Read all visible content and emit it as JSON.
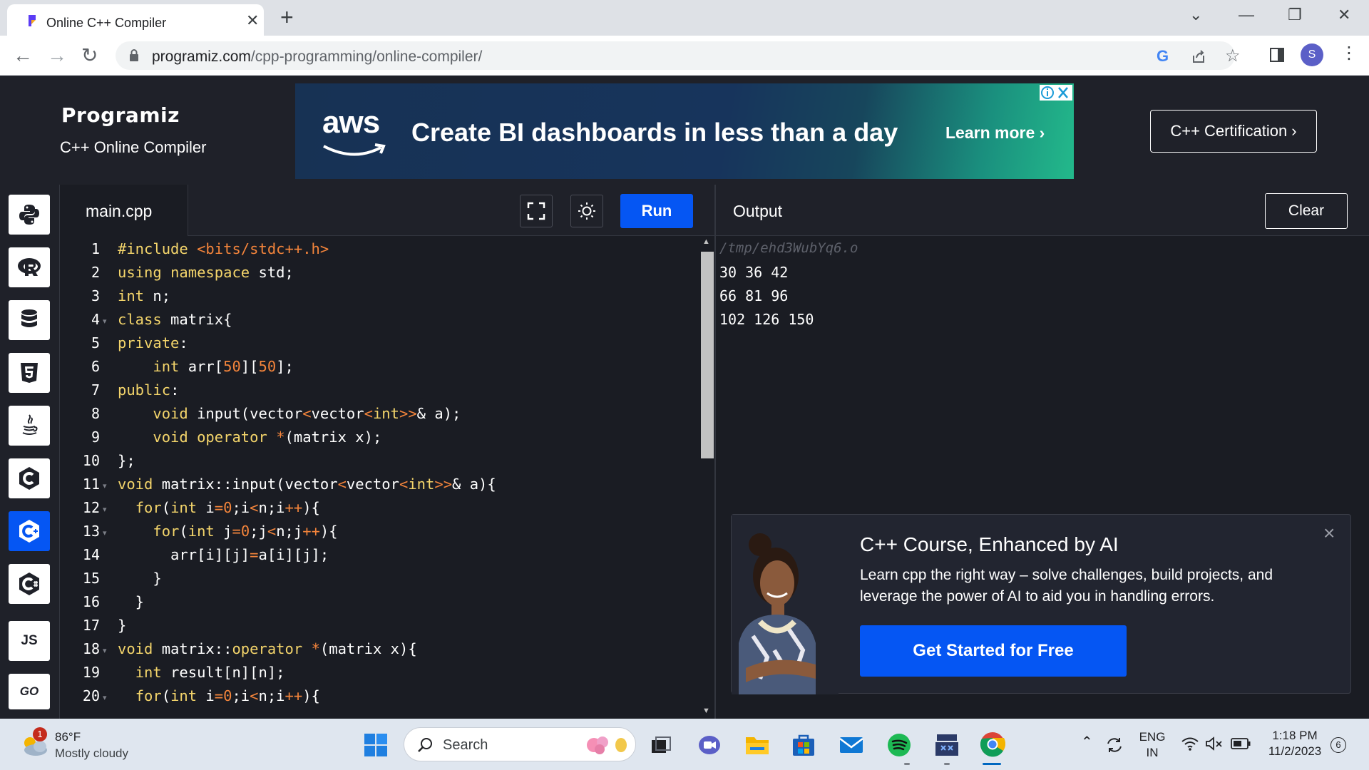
{
  "browser": {
    "tab_title": "Online C++ Compiler",
    "url_domain": "programiz.com",
    "url_path": "/cpp-programming/online-compiler/",
    "profile_initial": "S"
  },
  "header": {
    "logo": "Programiz",
    "subtitle": "C++ Online Compiler",
    "certification_label": "C++ Certification ›"
  },
  "ad": {
    "brand": "aws",
    "headline": "Create BI dashboards in less than a day",
    "cta": "Learn more ›"
  },
  "editor": {
    "file_name": "main.cpp",
    "run_label": "Run",
    "line_numbers": [
      "1",
      "2",
      "3",
      "4",
      "5",
      "6",
      "7",
      "8",
      "9",
      "10",
      "11",
      "12",
      "13",
      "14",
      "15",
      "16",
      "17",
      "18",
      "19",
      "20"
    ],
    "lines": [
      "#include <bits/stdc++.h>",
      "using namespace std;",
      "int n;",
      "class matrix{",
      "private:",
      "    int arr[50][50];",
      "public:",
      "    void input(vector<vector<int>>& a);",
      "    void operator *(matrix x);",
      "};",
      "void matrix::input(vector<vector<int>>& a){",
      "  for(int i=0;i<n;i++){",
      "    for(int j=0;j<n;j++){",
      "      arr[i][j]=a[i][j];",
      "    }",
      "  }",
      "}",
      "void matrix::operator *(matrix x){",
      "  int result[n][n];",
      "  for(int i=0;i<n;i++){"
    ]
  },
  "output": {
    "title": "Output",
    "clear_label": "Clear",
    "path": "/tmp/ehd3WubYq6.o",
    "lines": [
      "30 36 42",
      "66 81 96",
      "102 126 150"
    ]
  },
  "promo": {
    "title": "C++ Course, Enhanced by AI",
    "text": "Learn cpp the right way – solve challenges, build projects, and leverage the power of AI to aid you in handling errors.",
    "cta": "Get Started for Free"
  },
  "sidebar": {
    "languages": [
      "python-icon",
      "r-icon",
      "sql-icon",
      "html-icon",
      "java-icon",
      "c-icon",
      "cpp-icon",
      "csharp-icon",
      "javascript-icon",
      "go-icon"
    ],
    "js_label": "JS",
    "go_label": "GO"
  },
  "taskbar": {
    "weather_temp": "86°F",
    "weather_desc": "Mostly cloudy",
    "weather_badge": "1",
    "search_label": "Search",
    "lang_top": "ENG",
    "lang_bottom": "IN",
    "time": "1:18 PM",
    "date": "11/2/2023",
    "notif_count": "6"
  },
  "colors": {
    "accent": "#0556f3",
    "background": "#1f2129",
    "editor_bg": "#1a1c23",
    "keyword": "#f4d56b",
    "number": "#f3843b"
  }
}
